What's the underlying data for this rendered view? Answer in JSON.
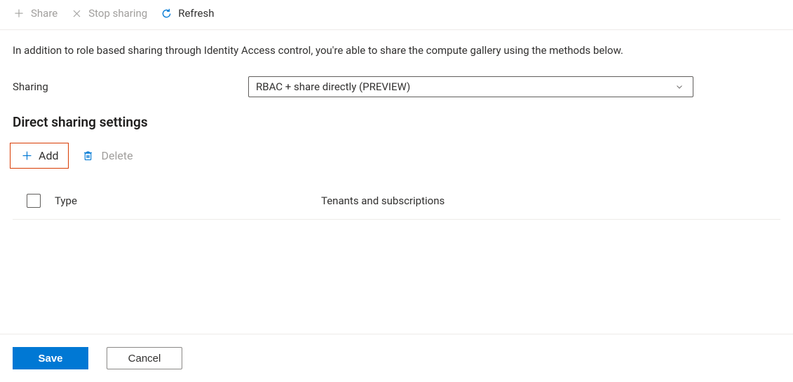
{
  "toolbar": {
    "share_label": "Share",
    "stop_sharing_label": "Stop sharing",
    "refresh_label": "Refresh"
  },
  "description": "In addition to role based sharing through Identity Access control, you're able to share the compute gallery using the methods below.",
  "form": {
    "sharing_label": "Sharing",
    "sharing_value": "RBAC + share directly (PREVIEW)"
  },
  "section": {
    "heading": "Direct sharing settings",
    "add_label": "Add",
    "delete_label": "Delete"
  },
  "table": {
    "columns": {
      "type": "Type",
      "tenants": "Tenants and subscriptions"
    },
    "rows": []
  },
  "footer": {
    "save_label": "Save",
    "cancel_label": "Cancel"
  },
  "colors": {
    "accent": "#0078d4",
    "highlight_border": "#d83b01"
  }
}
